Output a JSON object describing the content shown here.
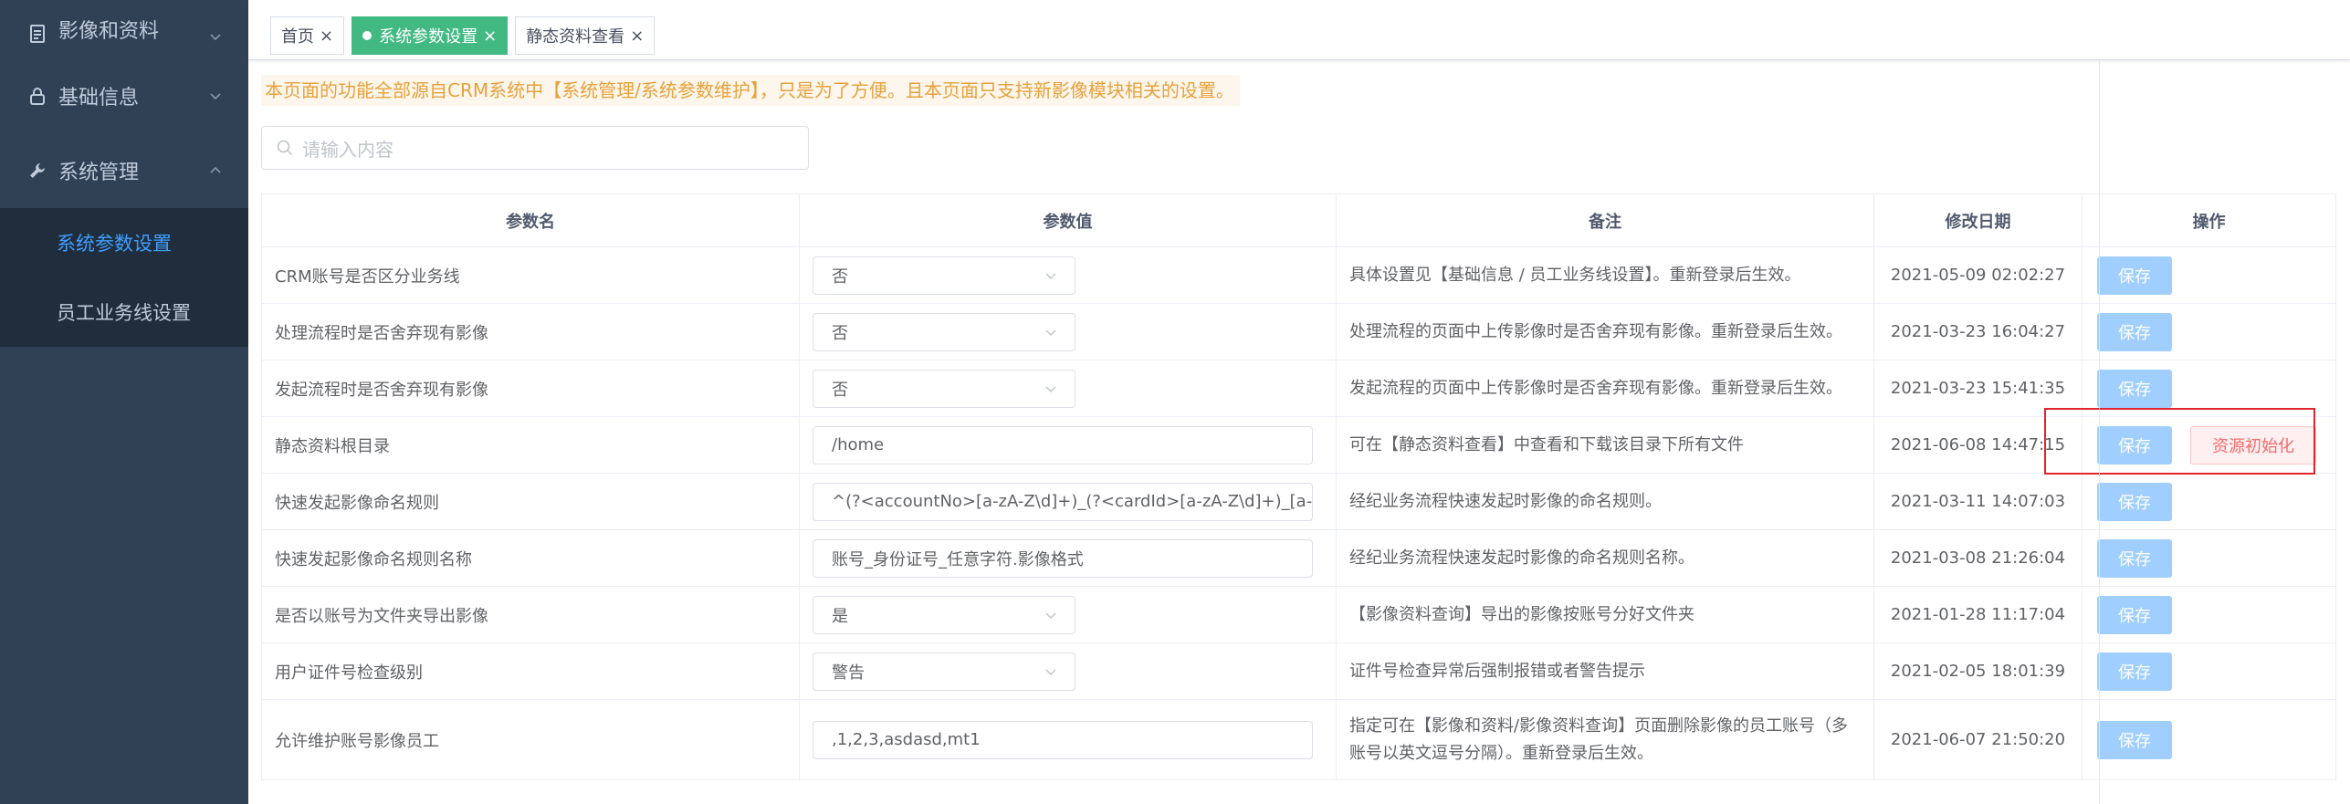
{
  "sidebar": {
    "groups": [
      {
        "label": "影像和资料",
        "icon": "document-icon",
        "expanded": false
      },
      {
        "label": "基础信息",
        "icon": "lock-icon",
        "expanded": false
      },
      {
        "label": "系统管理",
        "icon": "wrench-icon",
        "expanded": true
      }
    ],
    "submenu": [
      {
        "label": "系统参数设置",
        "active": true
      },
      {
        "label": "员工业务线设置",
        "active": false
      }
    ]
  },
  "tabs": [
    {
      "label": "首页",
      "active": false
    },
    {
      "label": "系统参数设置",
      "active": true
    },
    {
      "label": "静态资料查看",
      "active": false
    }
  ],
  "notice": "本页面的功能全部源自CRM系统中【系统管理/系统参数维护】，只是为了方便。且本页面只支持新影像模块相关的设置。",
  "search": {
    "placeholder": "请输入内容"
  },
  "table": {
    "headers": [
      "参数名",
      "参数值",
      "备注",
      "修改日期",
      "操作"
    ],
    "save_label": "保存",
    "init_label": "资源初始化",
    "rows": [
      {
        "name": "CRM账号是否区分业务线",
        "value": "否",
        "type": "select",
        "remark": "具体设置见【基础信息 / 员工业务线设置】。重新登录后生效。",
        "date": "2021-05-09 02:02:27"
      },
      {
        "name": "处理流程时是否舍弃现有影像",
        "value": "否",
        "type": "select",
        "remark": "处理流程的页面中上传影像时是否舍弃现有影像。重新登录后生效。",
        "date": "2021-03-23 16:04:27"
      },
      {
        "name": "发起流程时是否舍弃现有影像",
        "value": "否",
        "type": "select",
        "remark": "发起流程的页面中上传影像时是否舍弃现有影像。重新登录后生效。",
        "date": "2021-03-23 15:41:35"
      },
      {
        "name": "静态资料根目录",
        "value": "/home",
        "type": "input",
        "remark": "可在【静态资料查看】中查看和下载该目录下所有文件",
        "date": "2021-06-08 14:47:15"
      },
      {
        "name": "快速发起影像命名规则",
        "value": "^(?<accountNo>[a-zA-Z\\d]+)_(?<cardId>[a-zA-Z\\d]+)_[a-zA-Z\\d",
        "type": "input",
        "remark": "经纪业务流程快速发起时影像的命名规则。",
        "date": "2021-03-11 14:07:03"
      },
      {
        "name": "快速发起影像命名规则名称",
        "value": "账号_身份证号_任意字符.影像格式",
        "type": "input",
        "remark": "经纪业务流程快速发起时影像的命名规则名称。",
        "date": "2021-03-08 21:26:04"
      },
      {
        "name": "是否以账号为文件夹导出影像",
        "value": "是",
        "type": "select",
        "remark": "【影像资料查询】导出的影像按账号分好文件夹",
        "date": "2021-01-28 11:17:04"
      },
      {
        "name": "用户证件号检查级别",
        "value": "警告",
        "type": "select",
        "remark": "证件号检查异常后强制报错或者警告提示",
        "date": "2021-02-05 18:01:39"
      },
      {
        "name": "允许维护账号影像员工",
        "value": ",1,2,3,asdasd,mt1",
        "type": "input",
        "remark_line1": "指定可在【影像和资料/影像资料查询】页面删除影像的员工账号（多",
        "remark_line2": "账号以英文逗号分隔）。重新登录后生效。",
        "date": "2021-06-07 21:50:20"
      }
    ]
  }
}
